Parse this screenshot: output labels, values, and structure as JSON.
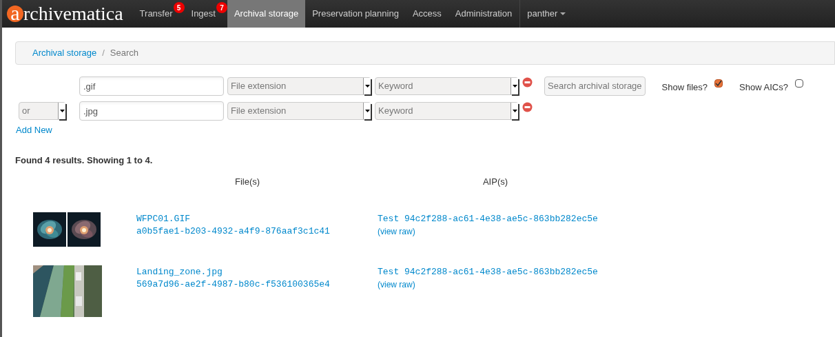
{
  "logo": {
    "initial": "a",
    "rest": "rchivematica"
  },
  "nav": [
    {
      "label": "Transfer",
      "badge": "5",
      "selected": false
    },
    {
      "label": "Ingest",
      "badge": "7",
      "selected": false
    },
    {
      "label": "Archival storage",
      "selected": true
    },
    {
      "label": "Preservation planning",
      "selected": false
    },
    {
      "label": "Access",
      "selected": false
    },
    {
      "label": "Administration",
      "selected": false
    }
  ],
  "user_menu": {
    "label": "panther"
  },
  "breadcrumb_separator": "/",
  "breadcrumb": [
    {
      "label": "Archival storage",
      "kind": "link"
    },
    {
      "label": "Search",
      "kind": "current"
    }
  ],
  "search_rows": [
    {
      "query": ".gif",
      "field": "File extension",
      "type": "Keyword"
    },
    {
      "operator": "or",
      "query": ".jpg",
      "field": "File extension",
      "type": "Keyword"
    }
  ],
  "add_new": "Add New",
  "search_button": "Search archival storage",
  "options": [
    {
      "label": "Show files?",
      "checked": true
    },
    {
      "label": "Show AICs?",
      "checked": false
    }
  ],
  "summary": "Found 4 results. Showing 1 to 4.",
  "columns": [
    "File(s)",
    "AIP(s)"
  ],
  "results": [
    {
      "thumbnails": [
        {
          "kind": "galaxy"
        },
        {
          "kind": "galaxy"
        }
      ],
      "file": "WFPC01.GIF",
      "uuid": "a0b5fae1-b203-4932-a4f9-876aaf3c1c41",
      "aip": "Test 94c2f288-ac61-4e38-ae5c-863bb282ec5e",
      "view": "(view raw)"
    },
    {
      "thumbnails": [
        {
          "kind": "aerial"
        }
      ],
      "file": "Landing_zone.jpg",
      "uuid": "569a7d96-ae2f-4987-b80c-f536100365e4",
      "aip": "Test 94c2f288-ac61-4e38-ae5c-863bb282ec5e",
      "view": "(view raw)"
    }
  ]
}
